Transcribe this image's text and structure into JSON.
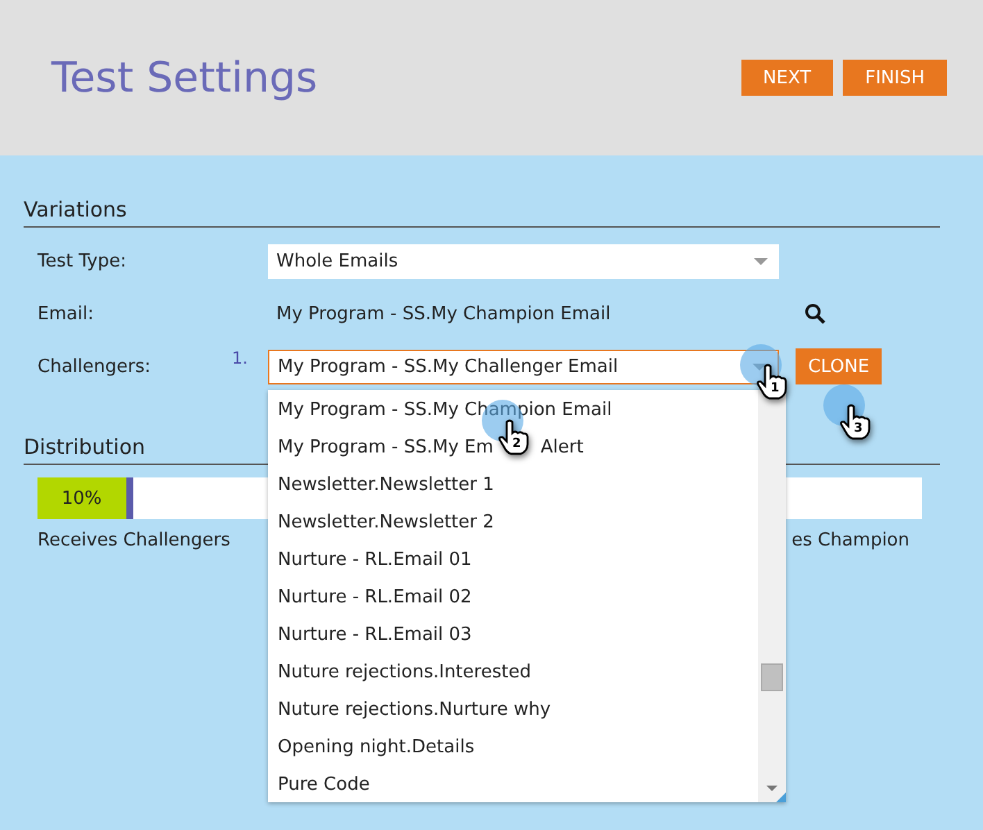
{
  "header": {
    "title": "Test Settings",
    "buttons": [
      "NEXT",
      "FINISH"
    ]
  },
  "variations": {
    "heading": "Variations",
    "test_type": {
      "label": "Test Type:",
      "value": "Whole Emails"
    },
    "email": {
      "label": "Email:",
      "value": "My Program - SS.My Champion Email"
    },
    "challengers": {
      "label": "Challengers:",
      "number": "1.",
      "value": "My Program - SS.My Challenger Email",
      "button": "CLONE"
    }
  },
  "distribution": {
    "heading": "Distribution",
    "level": 0.1,
    "reading": "10%",
    "left_label": "Receives Challengers",
    "right_label": "es Champion"
  },
  "dropdown": {
    "items": [
      {
        "label": "My Program - SS.My Champion Email",
        "selected": false
      },
      {
        "label": "My Program - SS.My Em",
        "label_end": "Alert",
        "selected": false
      },
      {
        "label": "Newsletter.Newsletter 1",
        "selected": false
      },
      {
        "label": "Newsletter.Newsletter 2",
        "selected": false
      },
      {
        "label": "Nurture - RL.Email 01",
        "selected": false
      },
      {
        "label": "Nurture - RL.Email 02",
        "selected": false
      },
      {
        "label": "Nurture - RL.Email 03",
        "selected": false
      },
      {
        "label": "Nuture rejections.Interested",
        "selected": false
      },
      {
        "label": "Nuture rejections.Nurture why",
        "selected": false
      },
      {
        "label": "Opening night.Details",
        "selected": false
      },
      {
        "label": "Pure Code",
        "selected": false
      }
    ]
  },
  "click_markers": [
    {
      "label": "1"
    },
    {
      "label": "2"
    },
    {
      "label": "3"
    }
  ]
}
